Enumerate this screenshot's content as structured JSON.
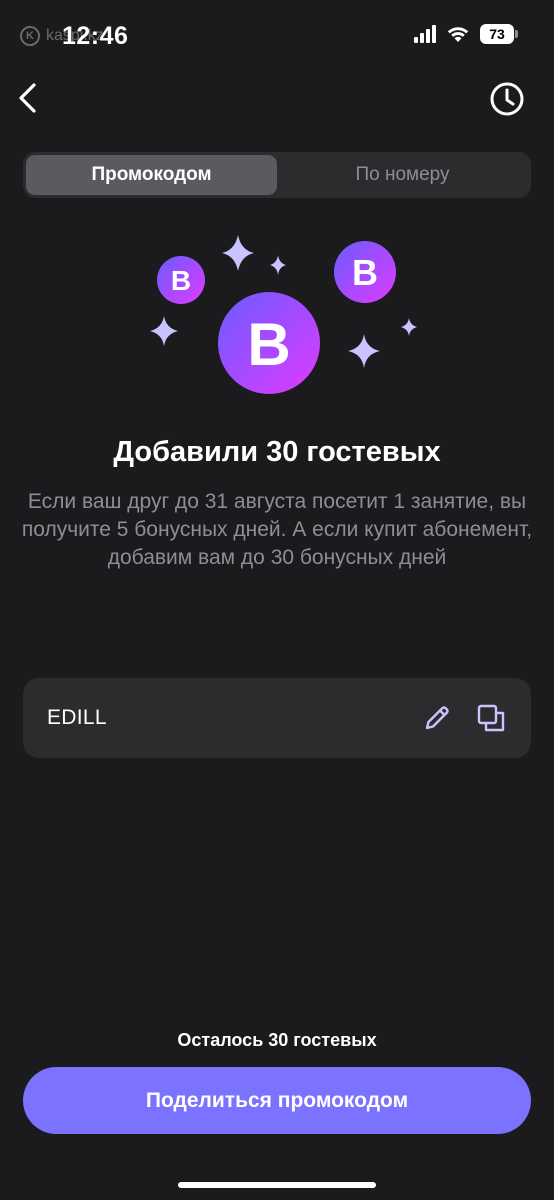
{
  "status_bar": {
    "time": "12:46",
    "battery": "73",
    "watermark": "kaspi.kz"
  },
  "nav": {
    "back_icon": "chevron-left-icon",
    "history_icon": "clock-icon"
  },
  "tabs": [
    {
      "label": "Промокодом",
      "active": true
    },
    {
      "label": "По номеру",
      "active": false
    }
  ],
  "illustration": {
    "badge_letter": "B",
    "accent_colors": [
      "#7b5cff",
      "#d43cff"
    ],
    "sparkle_color": "#c9c4ff"
  },
  "title": "Добавили 30 гостевых",
  "description": "Если ваш друг до 31 августа посетит 1 занятие, вы получите 5 бонусных дней. А если купит абонемент, добавим вам до 30 бонусных дней",
  "promo": {
    "code": "EDILL",
    "edit_icon": "pencil-icon",
    "copy_icon": "copy-icon"
  },
  "remaining": "Осталось 30 гостевых",
  "share_button": "Поделиться промокодом",
  "colors": {
    "background": "#1b1b1d",
    "accent": "#7b73ff",
    "surface": "#2c2c2f"
  }
}
